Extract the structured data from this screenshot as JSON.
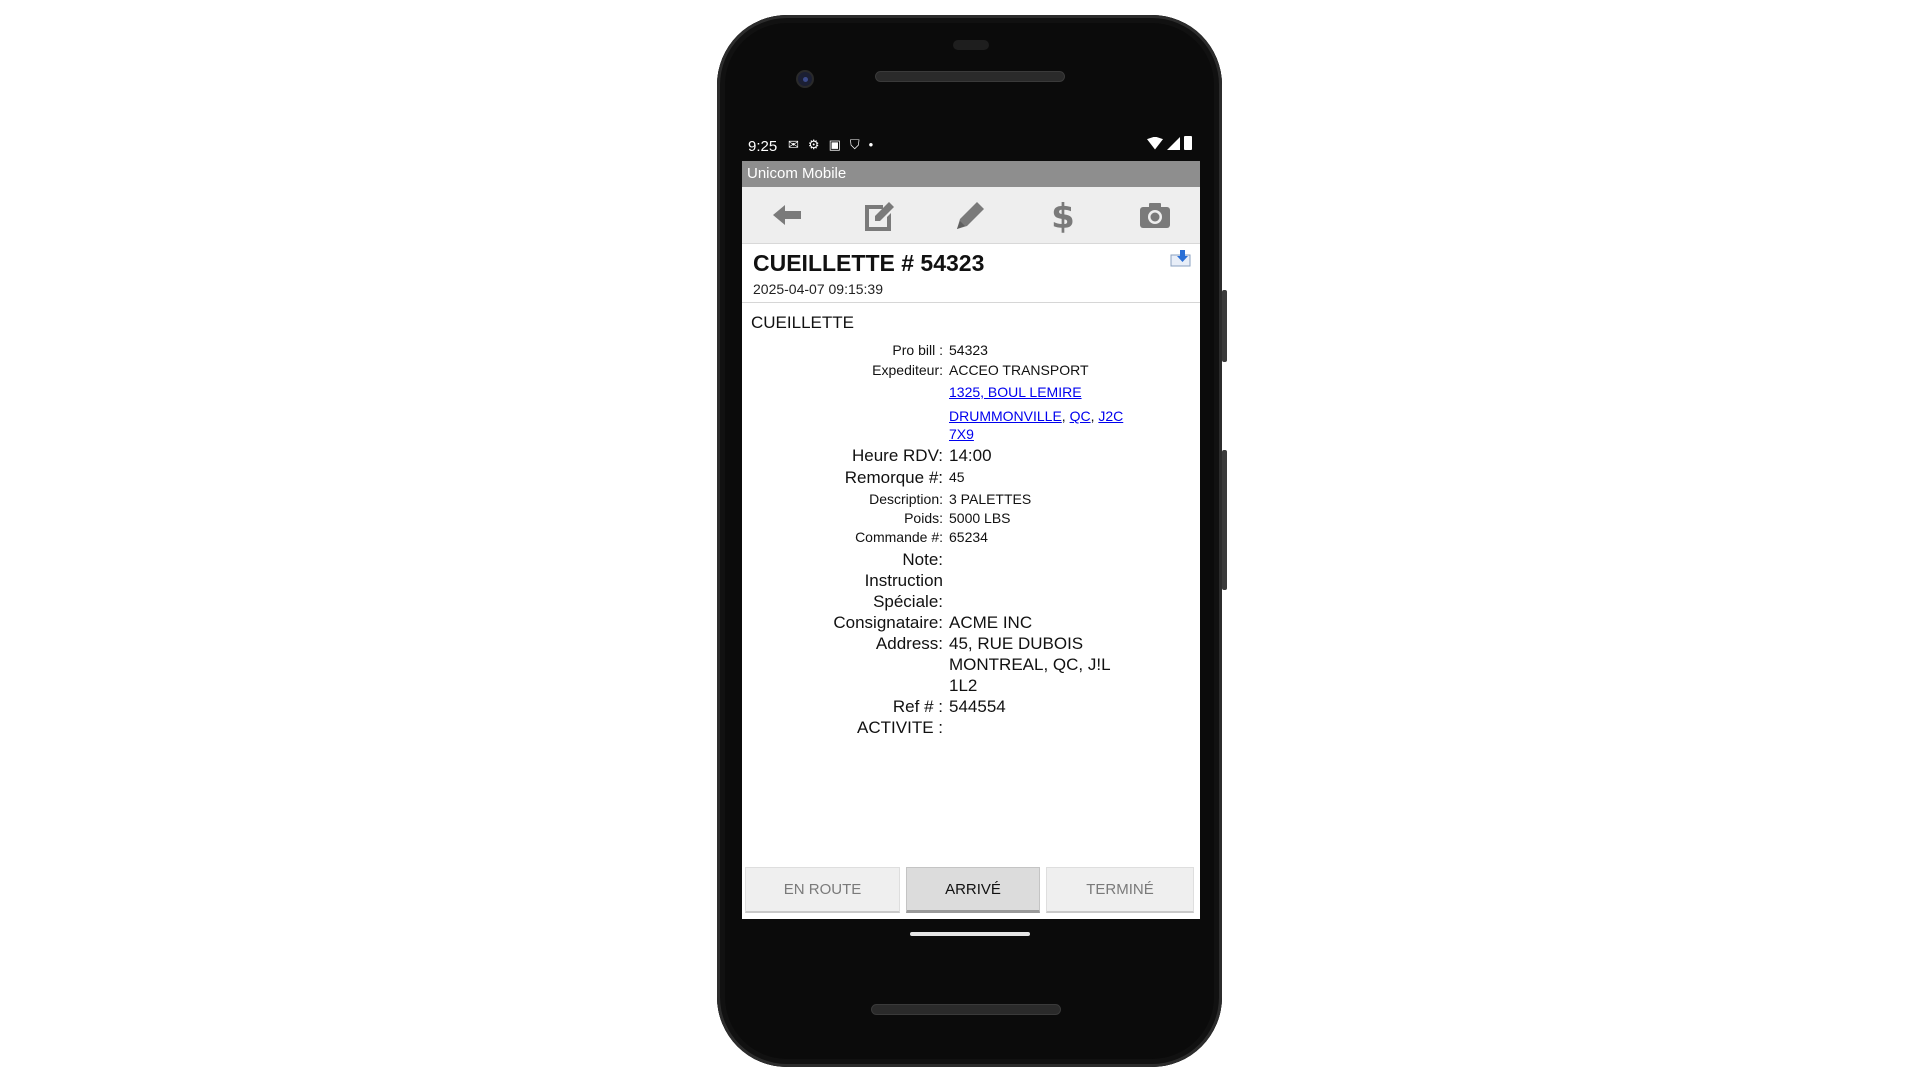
{
  "status_bar": {
    "time": "9:25",
    "icons": [
      "mail-icon",
      "gear-icon",
      "a-icon",
      "shield-icon",
      "dot"
    ],
    "right_icons": [
      "wifi-icon",
      "signal-icon",
      "battery-icon"
    ]
  },
  "app": {
    "title": "Unicom Mobile"
  },
  "toolbar": {
    "buttons": [
      "back-arrow-icon",
      "edit-note-icon",
      "pencil-icon",
      "dollar-icon",
      "camera-icon"
    ],
    "icon_color": "#7a7a7a"
  },
  "header": {
    "title": "CUEILLETTE # 54323",
    "datetime": "2025-04-07 09:15:39"
  },
  "section": {
    "label": "CUEILLETTE"
  },
  "details": {
    "probill_label": "Pro bill :",
    "probill_value": "54323",
    "expediteur_label": "Expediteur:",
    "expediteur_value": "ACCEO TRANSPORT",
    "addr_line1": "1325, BOUL LEMIRE",
    "addr_city": "DRUMMONVILLE",
    "addr_sep1": ",",
    "addr_prov": "QC",
    "addr_sep2": ",",
    "addr_postal_a": "J2C",
    "addr_postal_b": "7X9",
    "heure_label": "Heure RDV:",
    "heure_value": "14:00",
    "remorque_label": "Remorque  #:",
    "remorque_value": "45",
    "description_label": "Description:",
    "description_value": "3 PALETTES",
    "poids_label": "Poids:",
    "poids_value": "5000 LBS",
    "commande_label": "Commande #:",
    "commande_value": "65234",
    "note_label": "Note:",
    "note_value": "",
    "instruction_label_1": "Instruction",
    "instruction_label_2": "Spéciale:",
    "instruction_value": "",
    "consignataire_label": "Consignataire:",
    "consignataire_value": "ACME INC",
    "address_label": "Address:",
    "address_line1": "45, RUE DUBOIS",
    "address_line2": "MONTREAL, QC, J!L",
    "address_line3": "1L2",
    "ref_label": "Ref # :",
    "ref_value": "544554",
    "activite_label": "ACTIVITE :",
    "activite_value": ""
  },
  "bottom": {
    "en_route": "EN ROUTE",
    "arrive": "ARRIVÉ",
    "termine": "TERMINÉ",
    "active": "ARRIVÉ"
  },
  "colors": {
    "titlebar": "#8e8e8e",
    "link": "#0000ee",
    "toolbar_bg": "#eeeeee"
  }
}
